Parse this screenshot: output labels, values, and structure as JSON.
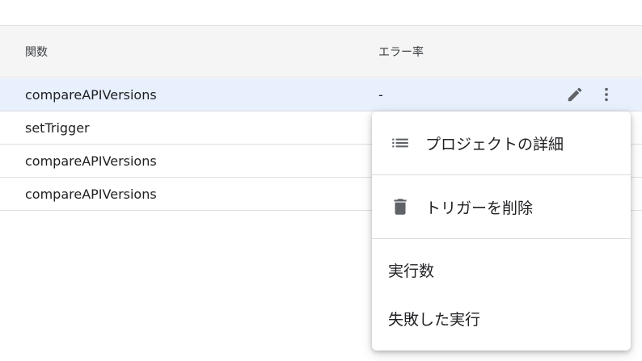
{
  "table": {
    "headers": {
      "function": "関数",
      "error_rate": "エラー率"
    },
    "rows": [
      {
        "function": "compareAPIVersions",
        "error_rate": "-"
      },
      {
        "function": "setTrigger",
        "error_rate": ""
      },
      {
        "function": "compareAPIVersions",
        "error_rate": ""
      },
      {
        "function": "compareAPIVersions",
        "error_rate": ""
      }
    ],
    "row_actions": {
      "edit_icon": "pencil-icon",
      "more_icon": "more-vert-icon"
    }
  },
  "context_menu": {
    "items": [
      {
        "label": "プロジェクトの詳細",
        "icon": "list-icon"
      },
      {
        "label": "トリガーを削除",
        "icon": "trash-icon"
      },
      {
        "label": "実行数"
      },
      {
        "label": "失敗した実行"
      }
    ]
  },
  "colors": {
    "selected_row": "#e8f0fe",
    "header_bg": "#f5f5f5",
    "icon": "#5f6368"
  }
}
